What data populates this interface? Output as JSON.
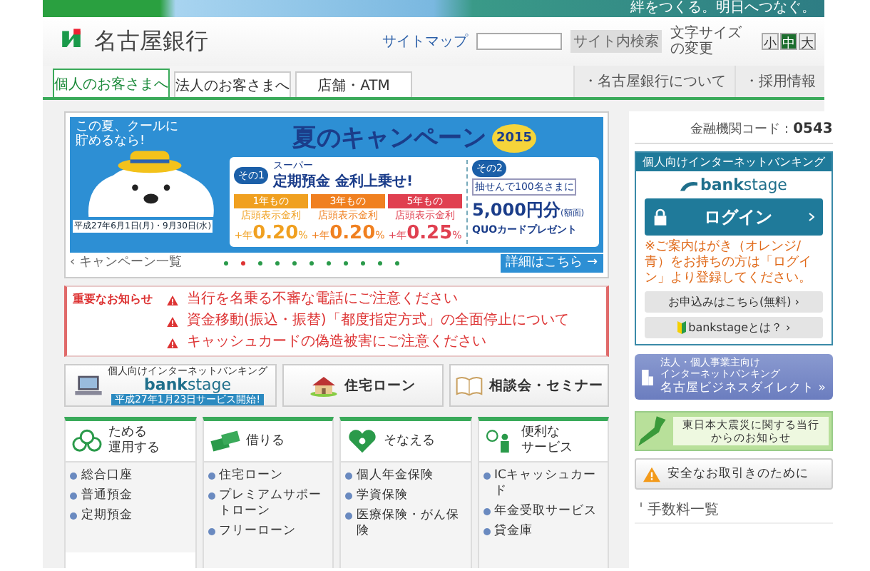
{
  "header": {
    "tagline": "絆をつくる。明日へつなぐ。",
    "bank_name": "名古屋銀行",
    "sitemap": "サイトマップ",
    "search_button": "サイト内検索",
    "font_size_label": "文字サイズの変更",
    "font_sizes": [
      {
        "label": "小",
        "selected": false
      },
      {
        "label": "中",
        "selected": true
      },
      {
        "label": "大",
        "selected": false
      }
    ]
  },
  "tabs": [
    {
      "label": "個人のお客さまへ",
      "selected": true
    },
    {
      "label": "法人のお客さまへ",
      "selected": false
    },
    {
      "label": "店舗・ATM",
      "selected": false
    }
  ],
  "nav_links": [
    "・名古屋銀行について",
    "・採用情報"
  ],
  "banner": {
    "catch": "この夏、クールに貯めるなら!",
    "title": "夏のキャンペーン",
    "year": "2015",
    "period": "平成27年6月1日(月)・9月30日(水)",
    "offer1": {
      "tag": "その1",
      "sub": "スーパー",
      "headline": "定期預金 金利上乗せ!",
      "rates": [
        {
          "term": "1年もの",
          "label": "店頭表示金利",
          "prefix": "+年",
          "value": "0.20",
          "unit": "%",
          "color": "#f0a020"
        },
        {
          "term": "3年もの",
          "label": "店頭表示金利",
          "prefix": "+年",
          "value": "0.20",
          "unit": "%",
          "color": "#f08020"
        },
        {
          "term": "5年もの",
          "label": "店頭表示金利",
          "prefix": "+年",
          "value": "0.25",
          "unit": "%",
          "color": "#e04050"
        }
      ]
    },
    "offer2": {
      "tag": "その2",
      "lottery": "抽せんで100名さまに",
      "amount": "5,000円分",
      "amount_note": "(額面)",
      "prize": "QUOカードプレゼント"
    },
    "list_link": "‹ キャンペーン一覧",
    "detail_link": "詳細はこちら →",
    "dots": [
      {
        "selected": false
      },
      {
        "selected": true
      },
      {
        "selected": false
      },
      {
        "selected": false
      },
      {
        "selected": false
      },
      {
        "selected": false
      },
      {
        "selected": false
      },
      {
        "selected": false
      },
      {
        "selected": false
      },
      {
        "selected": false
      },
      {
        "selected": false
      }
    ]
  },
  "notices": {
    "title": "重要なお知らせ",
    "items": [
      "当行を名乗る不審な電話にご注意ください",
      "資金移動(振込・振替)「都度指定方式」の全面停止について",
      "キャッシュカードの偽造被害にご注意ください"
    ]
  },
  "quick_links": [
    {
      "kind": "bankstage",
      "caption": "個人向けインターネットバンキング",
      "logo": "**bank**stage",
      "note": "平成27年1月23日サービス開始!"
    },
    {
      "kind": "house",
      "label": "住宅ローン"
    },
    {
      "kind": "book",
      "label": "相談会・セミナー"
    }
  ],
  "categories": [
    {
      "kind": "save",
      "title": [
        "ためる",
        "運用する"
      ],
      "items": [
        "総合口座",
        "普通預金",
        "定期預金"
      ]
    },
    {
      "kind": "borrow",
      "title": [
        "借りる"
      ],
      "items": [
        "住宅ローン",
        "プレミアムサポートローン",
        "フリーローン"
      ]
    },
    {
      "kind": "prepare",
      "title": [
        "そなえる"
      ],
      "items": [
        "個人年金保険",
        "学資保険",
        "医療保険・がん保険"
      ]
    },
    {
      "kind": "service",
      "title": [
        "便利な",
        "サービス"
      ],
      "items": [
        "ICキャッシュカード",
        "年金受取サービス",
        "貸金庫"
      ]
    }
  ],
  "sidebar": {
    "code_label": "金融機関コード：",
    "code": "0543",
    "ib": {
      "title": "個人向けインターネットバンキング",
      "logo": "**bank**stage",
      "login": "ログイン",
      "notice": "※ご案内はがき（オレンジ/青）をお持ちの方は「ログイン」より登録してください。",
      "apply": "お申込みはこちら(無料) ›",
      "about": "bankstageとは？ ›"
    },
    "business": {
      "caption": [
        "法人・個人事業主向け",
        "インターネットバンキング"
      ],
      "name": "名古屋ビジネスダイレクト »"
    },
    "quake": "東日本大震災に関する当行からのお知らせ",
    "safety": "安全なお取引きのために",
    "links": [
      "手数料一覧"
    ]
  }
}
